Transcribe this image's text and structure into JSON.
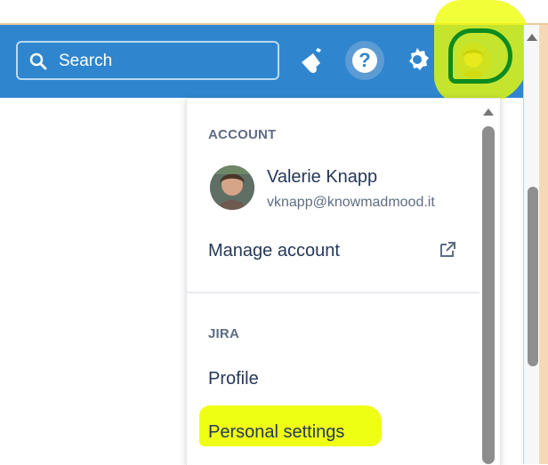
{
  "header": {
    "search_placeholder": "Search",
    "icons": [
      "search-icon",
      "megaphone-icon",
      "help-icon",
      "gear-icon",
      "avatar"
    ],
    "accent": "#2f86cf"
  },
  "menu": {
    "account_title": "ACCOUNT",
    "user_name": "Valerie Knapp",
    "email": "vknapp@knowmadmood.it",
    "manage_label": "Manage account",
    "jira_title": "JIRA",
    "profile_label": "Profile",
    "settings_label": "Personal settings"
  },
  "annotations": {
    "highlight_color": "#eeff00",
    "circle_color": "#0c8b1f"
  }
}
